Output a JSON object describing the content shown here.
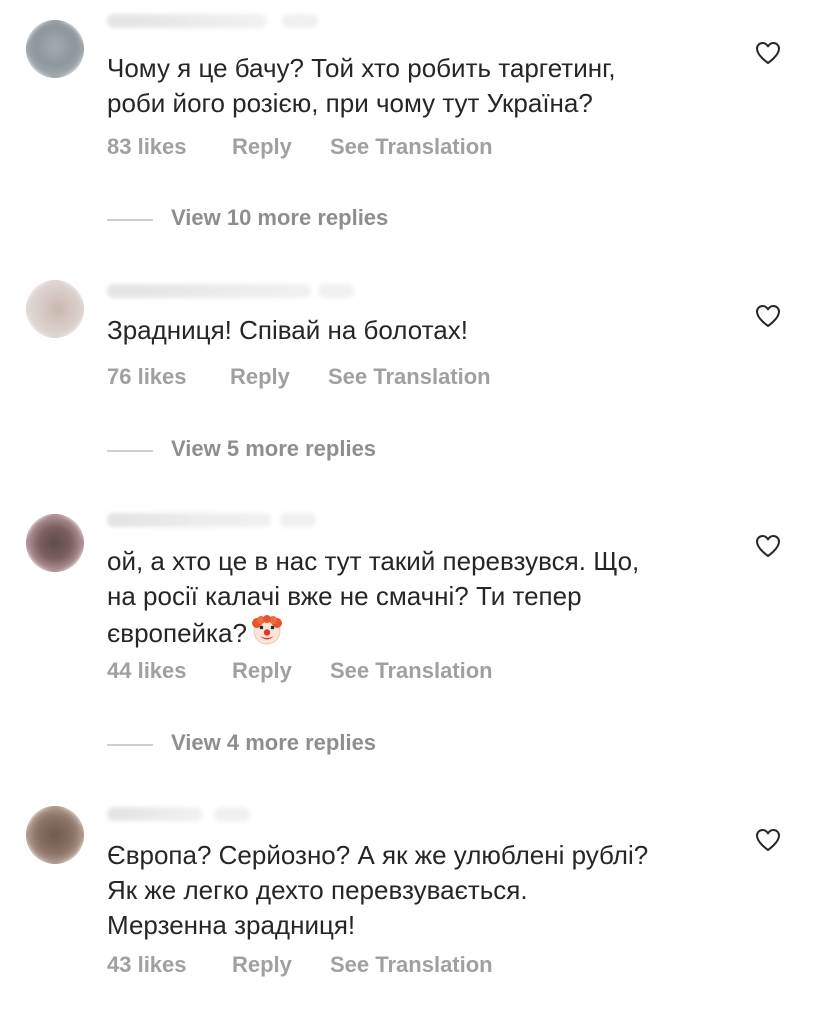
{
  "comments": [
    {
      "text_lines": [
        "Чому я це бачу? Той хто робить таргетинг,",
        "роби його розією, при чому тут Україна?"
      ],
      "likes": "83 likes",
      "reply": "Reply",
      "translate": "See Translation",
      "view_replies": "View 10 more replies",
      "avatar_icon": "user-avatar"
    },
    {
      "text_lines": [
        "Зрадниця! Співай на болотах!"
      ],
      "likes": "76 likes",
      "reply": "Reply",
      "translate": "See Translation",
      "view_replies": "View 5 more replies",
      "avatar_icon": "user-avatar"
    },
    {
      "text_lines": [
        "ой, а хто це в нас тут такий перевзувся. Що,",
        "на росії калачі вже не смачні? Ти тепер",
        "європейка?"
      ],
      "emoji": "clown-face",
      "likes": "44 likes",
      "reply": "Reply",
      "translate": "See Translation",
      "view_replies": "View 4 more replies",
      "avatar_icon": "user-avatar"
    },
    {
      "text_lines": [
        "Європа? Серйозно? А як же улюблені рублі?",
        "Як же легко дехто перевзувається.",
        "Мерзенна зрадниця!"
      ],
      "likes": "43 likes",
      "reply": "Reply",
      "translate": "See Translation",
      "avatar_icon": "user-avatar"
    }
  ],
  "icons": {
    "like": "heart-outline-icon"
  },
  "colors": {
    "text": "#262626",
    "meta": "#a0a0a0",
    "view_replies": "#8e8e8e",
    "background": "#ffffff"
  }
}
